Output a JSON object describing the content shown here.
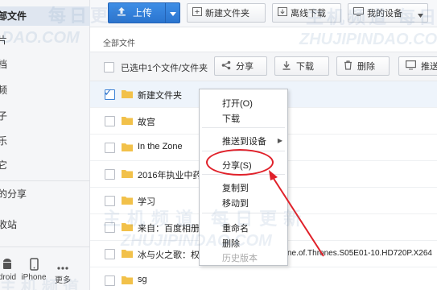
{
  "sidebar": {
    "items": [
      {
        "label": "部文件",
        "active": true
      },
      {
        "label": "片"
      },
      {
        "label": "档"
      },
      {
        "label": "频"
      },
      {
        "label": "子"
      },
      {
        "label": "乐"
      },
      {
        "label": "它"
      },
      {
        "label": "的分享"
      },
      {
        "label": "收站"
      }
    ],
    "devices": [
      {
        "label": "droid",
        "icon": "android-icon"
      },
      {
        "label": "iPhone",
        "icon": "iphone-icon"
      },
      {
        "label": "更多",
        "icon": "more-icon"
      }
    ]
  },
  "toolbar": {
    "upload_label": "上传",
    "new_folder_label": "新建文件夹",
    "offline_download_label": "离线下载",
    "my_devices_label": "我的设备"
  },
  "breadcrumb": "全部文件",
  "actionbar": {
    "selected_text": "已选中1个文件/文件夹",
    "share_label": "分享",
    "download_label": "下载",
    "delete_label": "删除",
    "push_label": "推送"
  },
  "files": [
    {
      "name": "新建文件夹",
      "selected": true
    },
    {
      "name": "故宫"
    },
    {
      "name": "In the Zone"
    },
    {
      "name": "2016年执业中药"
    },
    {
      "name": "学习"
    },
    {
      "name": "来自：百度相册"
    },
    {
      "name": "冰与火之歌：权力"
    },
    {
      "name": "sg"
    }
  ],
  "file_name_suffix": "ne.of.Thrones.S05E01-10.HD720P.X264",
  "context_menu": {
    "open": "打开(O)",
    "download": "下载",
    "push_to_device": "推送到设备",
    "share": "分享(S)",
    "copy_to": "复制到",
    "move_to": "移动到",
    "rename": "重命名",
    "delete": "删除",
    "history": "历史版本"
  },
  "watermarks": {
    "top_cn": "每日更新",
    "top_right_cn": "主机频道 每日",
    "url": "ZHUJIPINDAO.COM",
    "url_left": "DAO.COM",
    "mid_cn": "主机频道 每日更新",
    "bottom_cn": "主机频道"
  },
  "colors": {
    "accent_blue": "#2a74cf",
    "annotation_red": "#e0212a",
    "folder_yellow": "#f2c14a"
  }
}
